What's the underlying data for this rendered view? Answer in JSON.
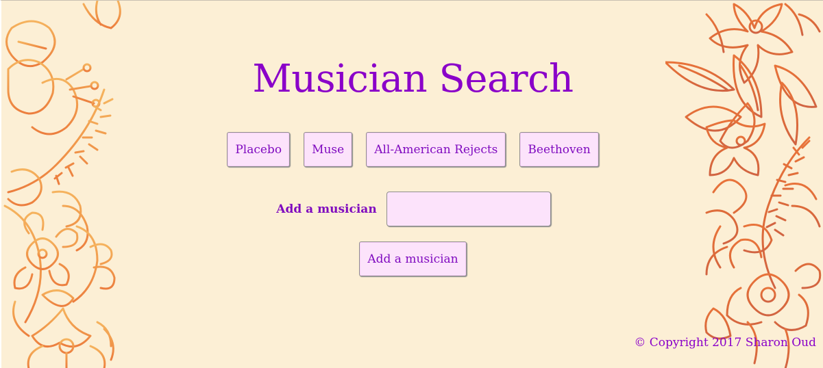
{
  "page": {
    "title": "Musician Search",
    "footer": "© Copyright 2017 Sharon Oud"
  },
  "musicians": [
    {
      "label": "Placebo"
    },
    {
      "label": "Muse"
    },
    {
      "label": "All-American Rejects"
    },
    {
      "label": "Beethoven"
    }
  ],
  "add_form": {
    "label": "Add a musician",
    "input_value": "",
    "button_label": "Add a musician"
  },
  "colors": {
    "background": "#fcefd5",
    "accent_text": "#8a00c9",
    "button_fill": "#fce3fb",
    "floral_orange": "#f0a050",
    "floral_red": "#d8603a"
  },
  "decorations": {
    "left": "floral-doodle-left",
    "right": "floral-doodle-right"
  }
}
